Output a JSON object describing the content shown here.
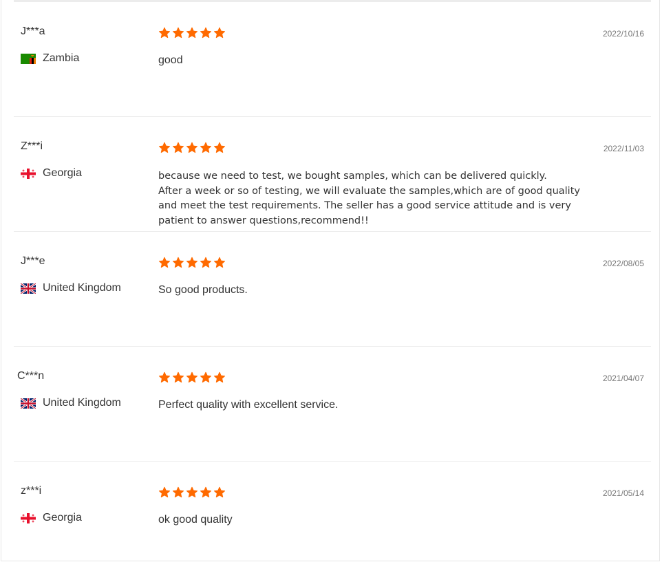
{
  "colors": {
    "star": "#ff6a00",
    "text": "#333333",
    "date": "#777777",
    "divider": "#ececec"
  },
  "rating_max": 5,
  "reviews": [
    {
      "name": "J***a",
      "country": "Zambia",
      "flag_icon": "zambia-flag-icon",
      "rating": 5,
      "text": "good",
      "date": "2022/10/16"
    },
    {
      "name": "Z***i",
      "country": "Georgia",
      "flag_icon": "georgia-flag-icon",
      "rating": 5,
      "text": "because we need to test, we bought samples, which can be delivered quickly.\nAfter a week or so of testing, we will evaluate the samples,which are of good quality\nand meet the test requirements. The seller has a good service attitude and is very\npatient to answer questions,recommend!!",
      "date": "2022/11/03"
    },
    {
      "name": "J***e",
      "country": "United Kingdom",
      "flag_icon": "uk-flag-icon",
      "rating": 5,
      "text": "So good products.",
      "date": "2022/08/05"
    },
    {
      "name": "C***n",
      "country": "United Kingdom",
      "flag_icon": "uk-flag-icon",
      "rating": 5,
      "text": "Perfect quality with excellent service.",
      "date": "2021/04/07"
    },
    {
      "name": "z***i",
      "country": "Georgia",
      "flag_icon": "georgia-flag-icon",
      "rating": 5,
      "text": "ok good quality",
      "date": "2021/05/14"
    }
  ]
}
